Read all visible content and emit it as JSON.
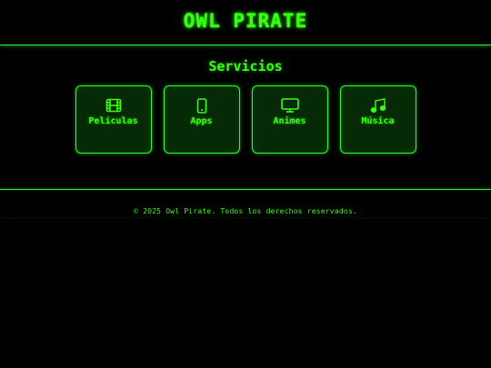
{
  "header": {
    "title": "OWL PIRATE"
  },
  "services": {
    "title": "Servicios",
    "items": [
      {
        "label": "Películas",
        "icon": "film-icon"
      },
      {
        "label": "Apps",
        "icon": "smartphone-icon"
      },
      {
        "label": "Animes",
        "icon": "tv-icon"
      },
      {
        "label": "Música",
        "icon": "music-note-icon"
      }
    ]
  },
  "footer": {
    "text": "© 2025 Owl Pirate. Todos los derechos reservados."
  },
  "colors": {
    "background": "#000000",
    "accent": "#39ff14",
    "card_bg": "#062a06"
  }
}
